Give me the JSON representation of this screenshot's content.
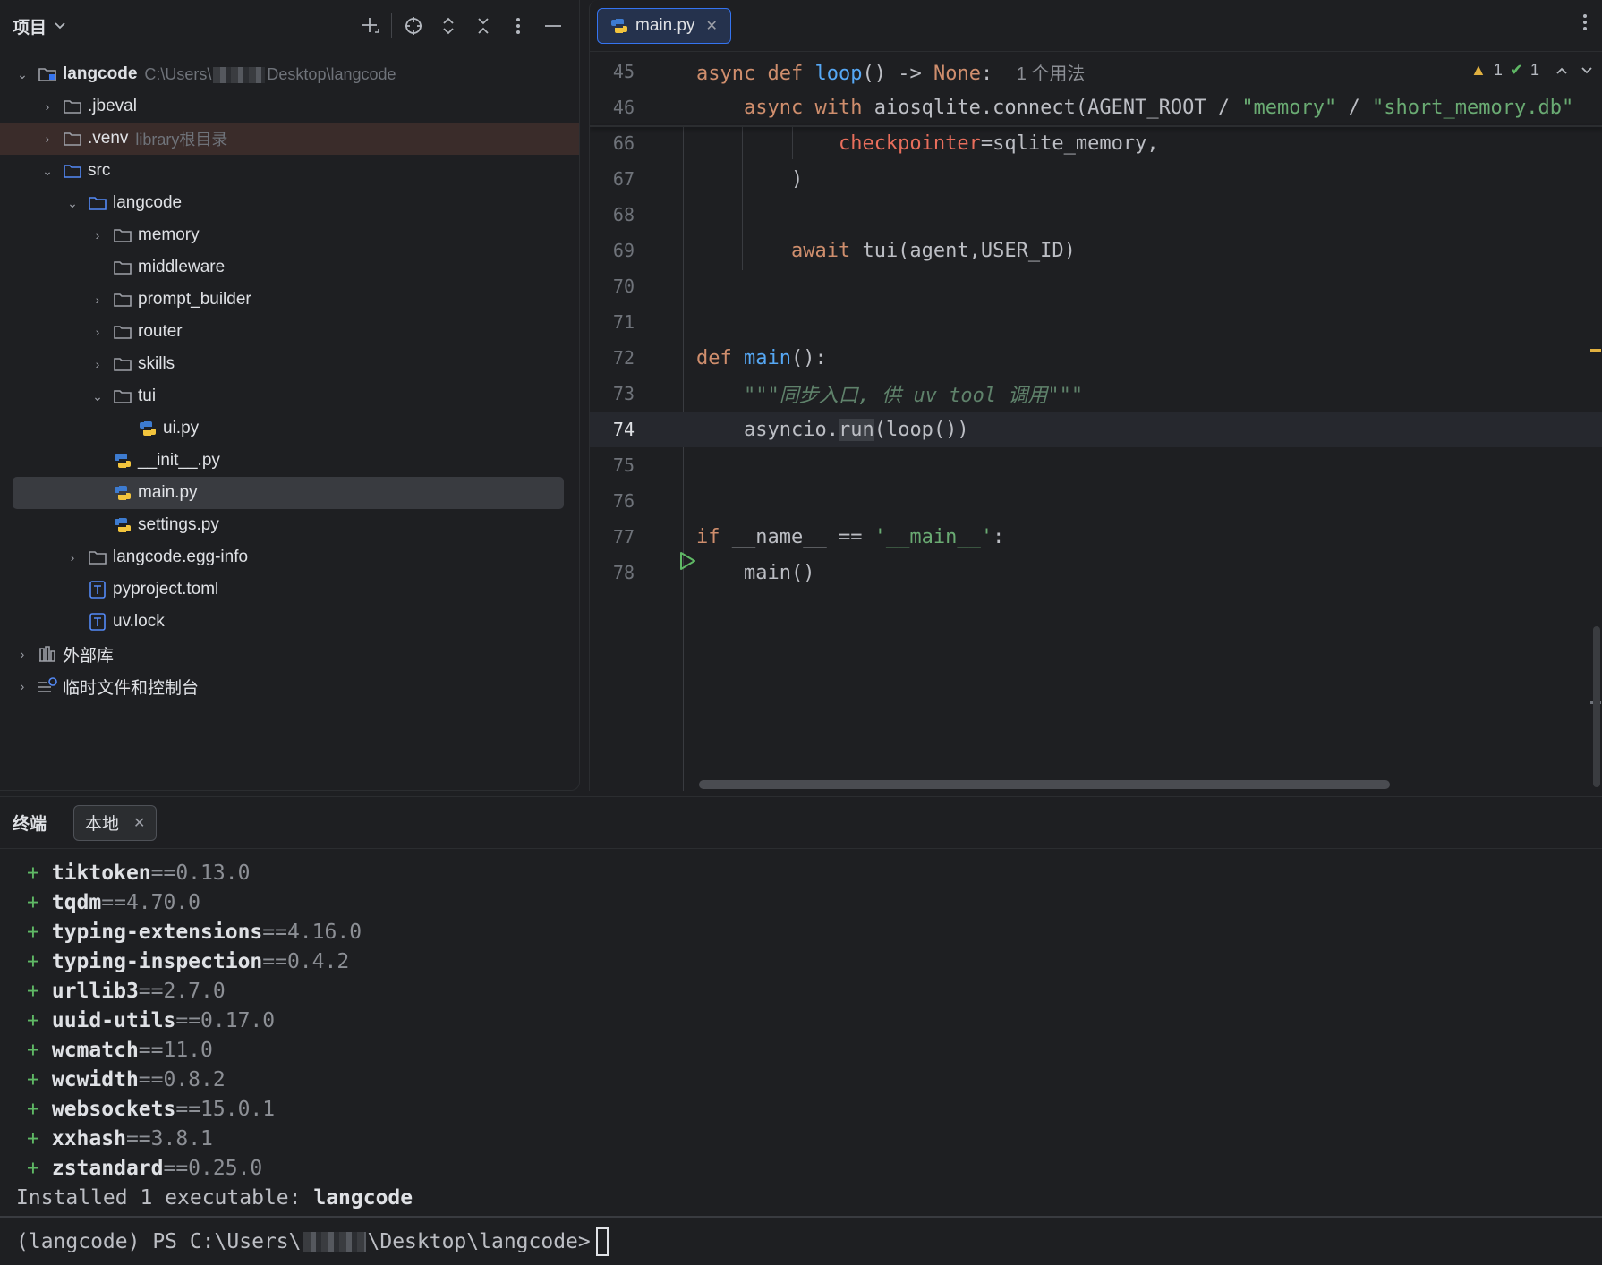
{
  "project": {
    "title": "项目",
    "tree": [
      {
        "label": "langcode",
        "hint_prefix": "C:\\Users\\",
        "hint_suffix": "Desktop\\langcode",
        "depth": 0,
        "expanded": true,
        "type": "project-root"
      },
      {
        "label": ".jbeval",
        "depth": 1,
        "expanded": false,
        "type": "folder"
      },
      {
        "label": ".venv",
        "hint": "library根目录",
        "depth": 1,
        "expanded": false,
        "type": "folder-excluded"
      },
      {
        "label": "src",
        "depth": 1,
        "expanded": true,
        "type": "folder-source"
      },
      {
        "label": "langcode",
        "depth": 2,
        "expanded": true,
        "type": "folder-source"
      },
      {
        "label": "memory",
        "depth": 3,
        "expanded": false,
        "type": "folder"
      },
      {
        "label": "middleware",
        "depth": 3,
        "type": "folder"
      },
      {
        "label": "prompt_builder",
        "depth": 3,
        "expanded": false,
        "type": "folder"
      },
      {
        "label": "router",
        "depth": 3,
        "expanded": false,
        "type": "folder"
      },
      {
        "label": "skills",
        "depth": 3,
        "expanded": false,
        "type": "folder"
      },
      {
        "label": "tui",
        "depth": 3,
        "expanded": true,
        "type": "folder"
      },
      {
        "label": "ui.py",
        "depth": 4,
        "type": "python"
      },
      {
        "label": "__init__.py",
        "depth": 3,
        "type": "python"
      },
      {
        "label": "main.py",
        "depth": 3,
        "type": "python",
        "selected": true
      },
      {
        "label": "settings.py",
        "depth": 3,
        "type": "python"
      },
      {
        "label": "langcode.egg-info",
        "depth": 2,
        "expanded": false,
        "type": "folder"
      },
      {
        "label": "pyproject.toml",
        "depth": 2,
        "type": "text"
      },
      {
        "label": "uv.lock",
        "depth": 2,
        "type": "text"
      },
      {
        "label": "外部库",
        "depth": 0,
        "expanded": false,
        "type": "library"
      },
      {
        "label": "临时文件和控制台",
        "depth": 0,
        "expanded": false,
        "type": "scratch"
      }
    ]
  },
  "editor": {
    "tab_label": "main.py",
    "inspections": {
      "warnings": "1",
      "ok": "1"
    },
    "lines": [
      {
        "num": "45",
        "sticky": true
      },
      {
        "num": "46",
        "sticky": true
      },
      {
        "num": "66"
      },
      {
        "num": "67"
      },
      {
        "num": "68"
      },
      {
        "num": "69"
      },
      {
        "num": "70"
      },
      {
        "num": "71"
      },
      {
        "num": "72"
      },
      {
        "num": "73"
      },
      {
        "num": "74",
        "current": true
      },
      {
        "num": "75"
      },
      {
        "num": "76"
      },
      {
        "num": "77",
        "run_icon": true
      },
      {
        "num": "78"
      }
    ],
    "code": {
      "l45_kw1": "async",
      "l45_kw2": "def",
      "l45_fn": "loop",
      "l45_rest": "() -> ",
      "l45_none": "None",
      "l45_colon": ":",
      "l45_inlay": "1 个用法",
      "l46_kw1": "async",
      "l46_kw2": "with",
      "l46_a": "aiosqlite.connect(AGENT_ROOT / ",
      "l46_s1": "\"memory\"",
      "l46_b": " / ",
      "l46_s2": "\"short_memory.db\"",
      "l66_param": "checkpointer",
      "l66_rest": "=sqlite_memory,",
      "l67": ")",
      "l69_kw": "await",
      "l69_rest": " tui(agent,USER_ID)",
      "l72_kw": "def",
      "l72_fn": "main",
      "l72_rest": "():",
      "l73_doc": "\"\"\"同步入口, 供 uv tool 调用\"\"\"",
      "l74_a": "asyncio.",
      "l74_b": "run",
      "l74_c": "(loop())",
      "l77_kw": "if",
      "l77_a": " __name__ == ",
      "l77_str": "'__main__'",
      "l77_b": ":",
      "l78": "main()"
    }
  },
  "terminal": {
    "title": "终端",
    "tab_label": "本地",
    "packages": [
      {
        "name": "tiktoken",
        "version": "==0.13.0"
      },
      {
        "name": "tqdm",
        "version": "==4.70.0"
      },
      {
        "name": "typing-extensions",
        "version": "==4.16.0"
      },
      {
        "name": "typing-inspection",
        "version": "==0.4.2"
      },
      {
        "name": "urllib3",
        "version": "==2.7.0"
      },
      {
        "name": "uuid-utils",
        "version": "==0.17.0"
      },
      {
        "name": "wcmatch",
        "version": "==11.0"
      },
      {
        "name": "wcwidth",
        "version": "==0.8.2"
      },
      {
        "name": "websockets",
        "version": "==15.0.1"
      },
      {
        "name": "xxhash",
        "version": "==3.8.1"
      },
      {
        "name": "zstandard",
        "version": "==0.25.0"
      }
    ],
    "plus_sign": "+",
    "installed_prefix": "Installed 1 executable: ",
    "installed_exe": "langcode",
    "prompt_prefix": "(langcode) PS C:\\Users\\",
    "prompt_suffix": "\\Desktop\\langcode>"
  },
  "icons": {
    "add": "plus-icon",
    "locate": "crosshair-icon",
    "expand": "expand-all-icon",
    "collapse": "collapse-all-icon",
    "more": "more-vertical-icon",
    "minimize": "minimize-icon"
  },
  "colors": {
    "accent": "#3574f0",
    "keyword": "#cf8e6d",
    "function": "#56a8f5",
    "string": "#6aab73",
    "docstring": "#5f826b",
    "parameter": "#e86e5c",
    "warning": "#e0b040",
    "success": "#5fb865"
  }
}
